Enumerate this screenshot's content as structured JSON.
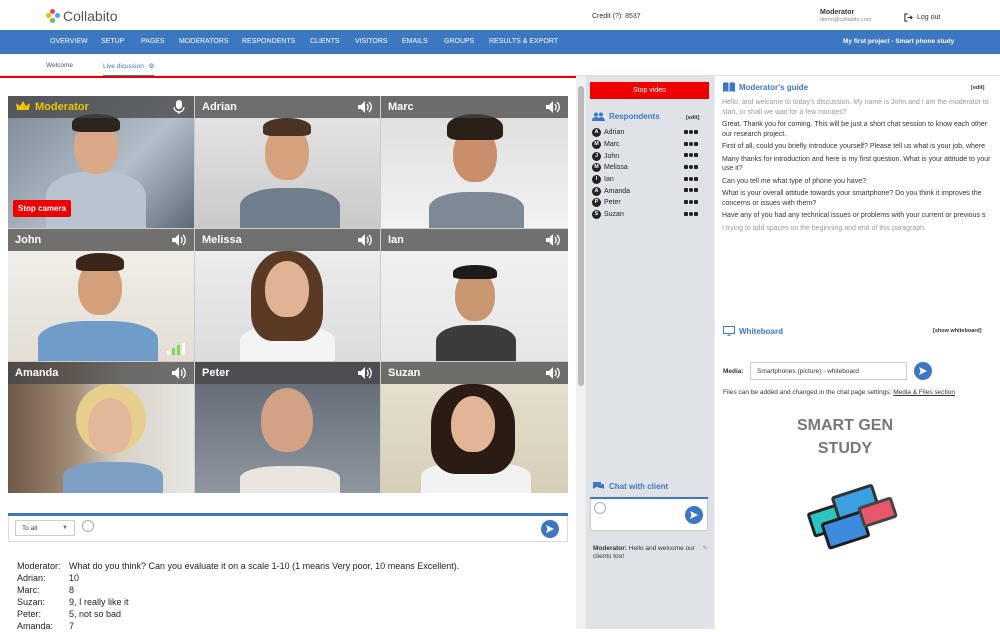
{
  "app": {
    "name": "Collabito",
    "credit_label": "Credit (?):",
    "credit_value": "8537",
    "user_role": "Moderator",
    "user_email": "demo@collabito.com",
    "logout_label": "Log out"
  },
  "nav": {
    "items": [
      "OVERVIEW",
      "SETUP",
      "PAGES",
      "MODERATORS",
      "RESPONDENTS",
      "CLIENTS",
      "VISITORS",
      "EMAILS",
      "GROUPS",
      "RESULTS & EXPORT"
    ],
    "project": "My first project - Smart phone study"
  },
  "subtabs": {
    "welcome": "Welcome",
    "live": "Live dicussion"
  },
  "video": {
    "tiles": [
      {
        "name": "Moderator",
        "is_moderator": true
      },
      {
        "name": "Adrian"
      },
      {
        "name": "Marc"
      },
      {
        "name": "John"
      },
      {
        "name": "Melissa"
      },
      {
        "name": "Ian"
      },
      {
        "name": "Amanda"
      },
      {
        "name": "Peter"
      },
      {
        "name": "Suzan"
      }
    ],
    "stop_camera": "Stop camera"
  },
  "chat": {
    "recipient": "To all",
    "messages": [
      {
        "who": "Moderator:",
        "text": "What do you think? Can you evaluate it on a scale 1-10 (1 means Very poor, 10 means Excellent)."
      },
      {
        "who": "Adrian:",
        "text": "10"
      },
      {
        "who": "Marc:",
        "text": "8"
      },
      {
        "who": "Suzan:",
        "text": "9, I really like it"
      },
      {
        "who": "Peter:",
        "text": "5, not so bad"
      },
      {
        "who": "Amanda:",
        "text": "7"
      }
    ]
  },
  "side": {
    "stop_video": "Stop video",
    "respondents_title": "Respondents",
    "edit_label": "[edit]",
    "respondents": [
      {
        "initial": "A",
        "name": "Adrian"
      },
      {
        "initial": "M",
        "name": "Marc"
      },
      {
        "initial": "J",
        "name": "John"
      },
      {
        "initial": "M",
        "name": "Melissa"
      },
      {
        "initial": "I",
        "name": "Ian"
      },
      {
        "initial": "A",
        "name": "Amanda"
      },
      {
        "initial": "P",
        "name": "Peter"
      },
      {
        "initial": "S",
        "name": "Suzan"
      }
    ],
    "client_chat_title": "Chat with client",
    "client_msg_who": "Moderator:",
    "client_msg_text": "Hello and welcome our clients too!"
  },
  "guide": {
    "title": "Moderator's guide",
    "edit_label": "[edit]",
    "paragraphs": [
      {
        "text": "Hello, and welcome to today's discussion. My name is John and I am the moderator to start, or shall we wait for a few minutes?",
        "grey": true
      },
      {
        "text": "Great. Thank you for coming. This will be just a short chat session to know each other our research project.",
        "grey": false
      },
      {
        "text": "First of all, could you briefly introduce yourself? Please tell us what is your job, where",
        "grey": false
      },
      {
        "text": "Many thanks for introduction and here is my first question. What is your attitude to your use it?",
        "grey": false
      },
      {
        "text": "Can you tell me what type of phone you have?",
        "grey": false
      },
      {
        "text": "What is your overall attitude towards your smartphone? Do you think it improves the concerns or issues with them?",
        "grey": false
      },
      {
        "text": "Have any of you had any technical issues or problems with your current or previous s",
        "grey": false
      },
      {
        "text": "  I trying to add spaces on the beginning and end of this  paragraph.",
        "grey": true
      }
    ]
  },
  "whiteboard": {
    "title": "Whiteboard",
    "show_label": "[show whiteboard]",
    "media_label": "Media:",
    "media_value": "Smartphones (picture) - whiteboard",
    "files_note": "Files can be added and changed in the chat page settings:",
    "files_link": "Media & Files section",
    "image_text_1": "SMART GEN",
    "image_text_2": "STUDY"
  },
  "colors": {
    "brand": "#3d77c2",
    "danger": "#e00000",
    "moderator_gold": "#f2c200"
  }
}
